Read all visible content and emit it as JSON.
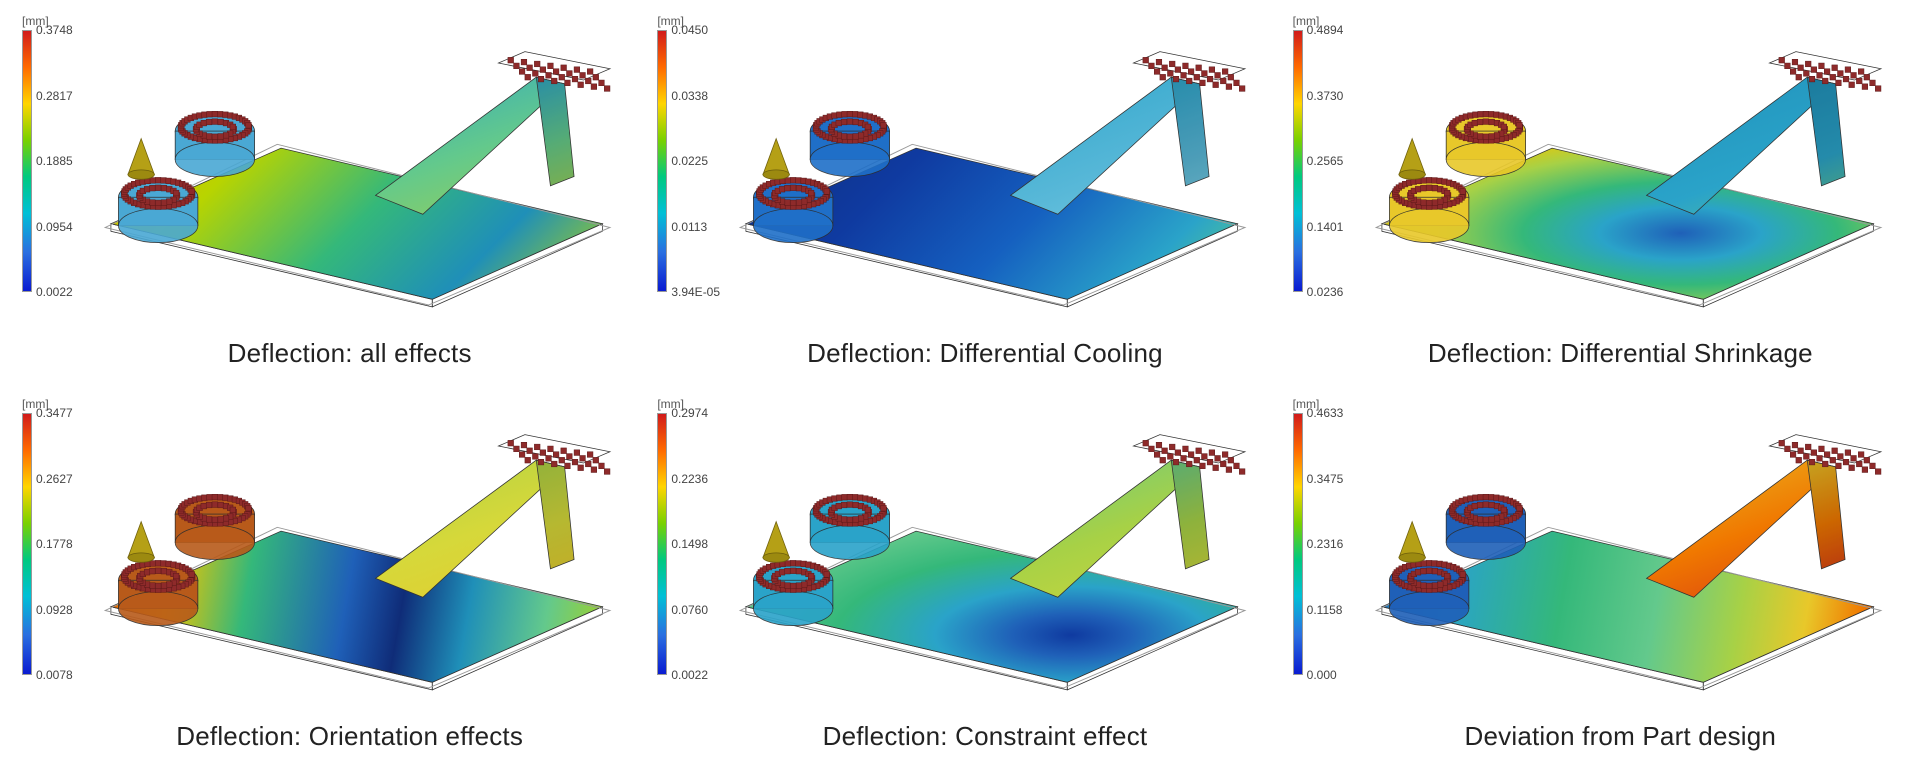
{
  "chart_data": [
    {
      "type": "heatmap",
      "title": "Deflection: all effects",
      "unit": "[mm]",
      "ylim": [
        0.0022,
        0.3748
      ],
      "ticks": [
        {
          "pos": 0.0,
          "label": "0.3748"
        },
        {
          "pos": 0.25,
          "label": "0.2817"
        },
        {
          "pos": 0.5,
          "label": "0.1885"
        },
        {
          "pos": 0.75,
          "label": "0.0954"
        },
        {
          "pos": 1.0,
          "label": "0.0022"
        }
      ],
      "render_variant": "yellow-green"
    },
    {
      "type": "heatmap",
      "title": "Deflection: Differential Cooling",
      "unit": "[mm]",
      "ylim": [
        3.94e-05,
        0.045
      ],
      "ticks": [
        {
          "pos": 0.0,
          "label": "0.0450"
        },
        {
          "pos": 0.25,
          "label": "0.0338"
        },
        {
          "pos": 0.5,
          "label": "0.0225"
        },
        {
          "pos": 0.75,
          "label": "0.0113"
        },
        {
          "pos": 1.0,
          "label": "3.94E-05"
        }
      ],
      "render_variant": "blue-cyan"
    },
    {
      "type": "heatmap",
      "title": "Deflection: Differential Shrinkage",
      "unit": "[mm]",
      "ylim": [
        0.0236,
        0.4894
      ],
      "ticks": [
        {
          "pos": 0.0,
          "label": "0.4894"
        },
        {
          "pos": 0.25,
          "label": "0.3730"
        },
        {
          "pos": 0.5,
          "label": "0.2565"
        },
        {
          "pos": 0.75,
          "label": "0.1401"
        },
        {
          "pos": 1.0,
          "label": "0.0236"
        }
      ],
      "render_variant": "green-yellow-red"
    },
    {
      "type": "heatmap",
      "title": "Deflection: Orientation effects",
      "unit": "[mm]",
      "ylim": [
        0.0078,
        0.3477
      ],
      "ticks": [
        {
          "pos": 0.0,
          "label": "0.3477"
        },
        {
          "pos": 0.25,
          "label": "0.2627"
        },
        {
          "pos": 0.5,
          "label": "0.1778"
        },
        {
          "pos": 0.75,
          "label": "0.0928"
        },
        {
          "pos": 1.0,
          "label": "0.0078"
        }
      ],
      "render_variant": "red-blue-green"
    },
    {
      "type": "heatmap",
      "title": "Deflection: Constraint effect",
      "unit": "[mm]",
      "ylim": [
        0.0022,
        0.2974
      ],
      "ticks": [
        {
          "pos": 0.0,
          "label": "0.2974"
        },
        {
          "pos": 0.25,
          "label": "0.2236"
        },
        {
          "pos": 0.5,
          "label": "0.1498"
        },
        {
          "pos": 0.75,
          "label": "0.0760"
        },
        {
          "pos": 1.0,
          "label": "0.0022"
        }
      ],
      "render_variant": "green-blue"
    },
    {
      "type": "heatmap",
      "title": "Deviation from Part design",
      "unit": "[mm]",
      "ylim": [
        0.0,
        0.4633
      ],
      "ticks": [
        {
          "pos": 0.0,
          "label": "0.4633"
        },
        {
          "pos": 0.25,
          "label": "0.3475"
        },
        {
          "pos": 0.5,
          "label": "0.2316"
        },
        {
          "pos": 0.75,
          "label": "0.1158"
        },
        {
          "pos": 1.0,
          "label": "0.000"
        }
      ],
      "render_variant": "blue-green-red"
    }
  ]
}
